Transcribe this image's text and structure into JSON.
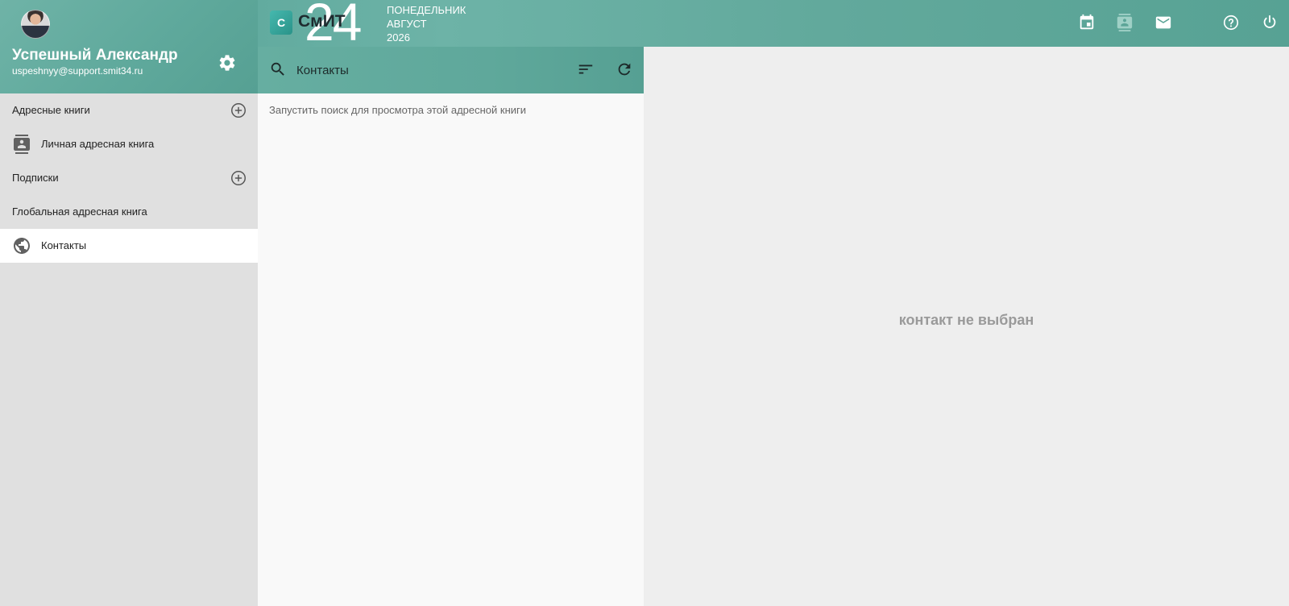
{
  "user": {
    "name": "Успешный Александр",
    "email": "uspeshnyy@support.smit34.ru"
  },
  "brand": {
    "logo_letter": "С",
    "logo_text": "СмИТ",
    "logo_number": "24"
  },
  "date": {
    "weekday": "ПОНЕДЕЛЬНИК",
    "month": "АВГУСТ",
    "year": "2026"
  },
  "sidebar": {
    "sections": [
      {
        "label": "Адресные книги",
        "items": [
          {
            "label": "Личная адресная книга",
            "icon": "contact-book-icon"
          }
        ]
      },
      {
        "label": "Подписки",
        "items": []
      },
      {
        "label": "Глобальная адресная книга",
        "items": [
          {
            "label": "Контакты",
            "icon": "globe-icon",
            "active": true
          }
        ]
      }
    ]
  },
  "toolbar": {
    "icons": [
      "calendar-icon",
      "contacts-icon",
      "mail-icon",
      "help-icon",
      "power-icon"
    ]
  },
  "search": {
    "placeholder": "Контакты"
  },
  "list": {
    "hint": "Запустить поиск для просмотра этой адресной книги"
  },
  "detail": {
    "empty": "контакт не выбран"
  },
  "colors": {
    "header_teal": "#5fa99c",
    "active_item": "#ffffff",
    "sidebar_bg": "#e0e0e0"
  }
}
